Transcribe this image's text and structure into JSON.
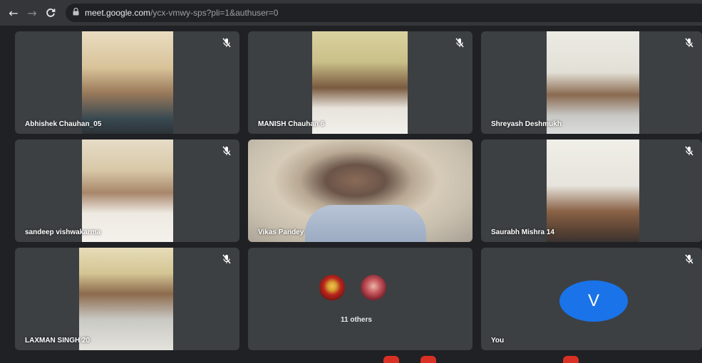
{
  "browser": {
    "back_icon": "←",
    "forward_icon": "→",
    "reload_icon": "C",
    "lock_icon": "🔒",
    "url_host": "meet.google.com",
    "url_path": "/ycx-vmwy-sps?pli=1&authuser=0"
  },
  "colors": {
    "tile_bg": "#3c4043",
    "stage_bg": "#202124",
    "avatar_blue": "#1a73e8"
  },
  "participants": [
    {
      "name": "Abhishek Chauhan_05"
    },
    {
      "name": "MANISH Chauhan 6"
    },
    {
      "name": "Shreyash Deshmukh"
    },
    {
      "name": "sandeep vishwakarma"
    },
    {
      "name": "Vikas Pandey"
    },
    {
      "name": "Saurabh Mishra 14"
    },
    {
      "name": "LAXMAN SINGH 20"
    }
  ],
  "others": {
    "label": "11 others"
  },
  "self": {
    "name": "You",
    "initial": "V"
  }
}
